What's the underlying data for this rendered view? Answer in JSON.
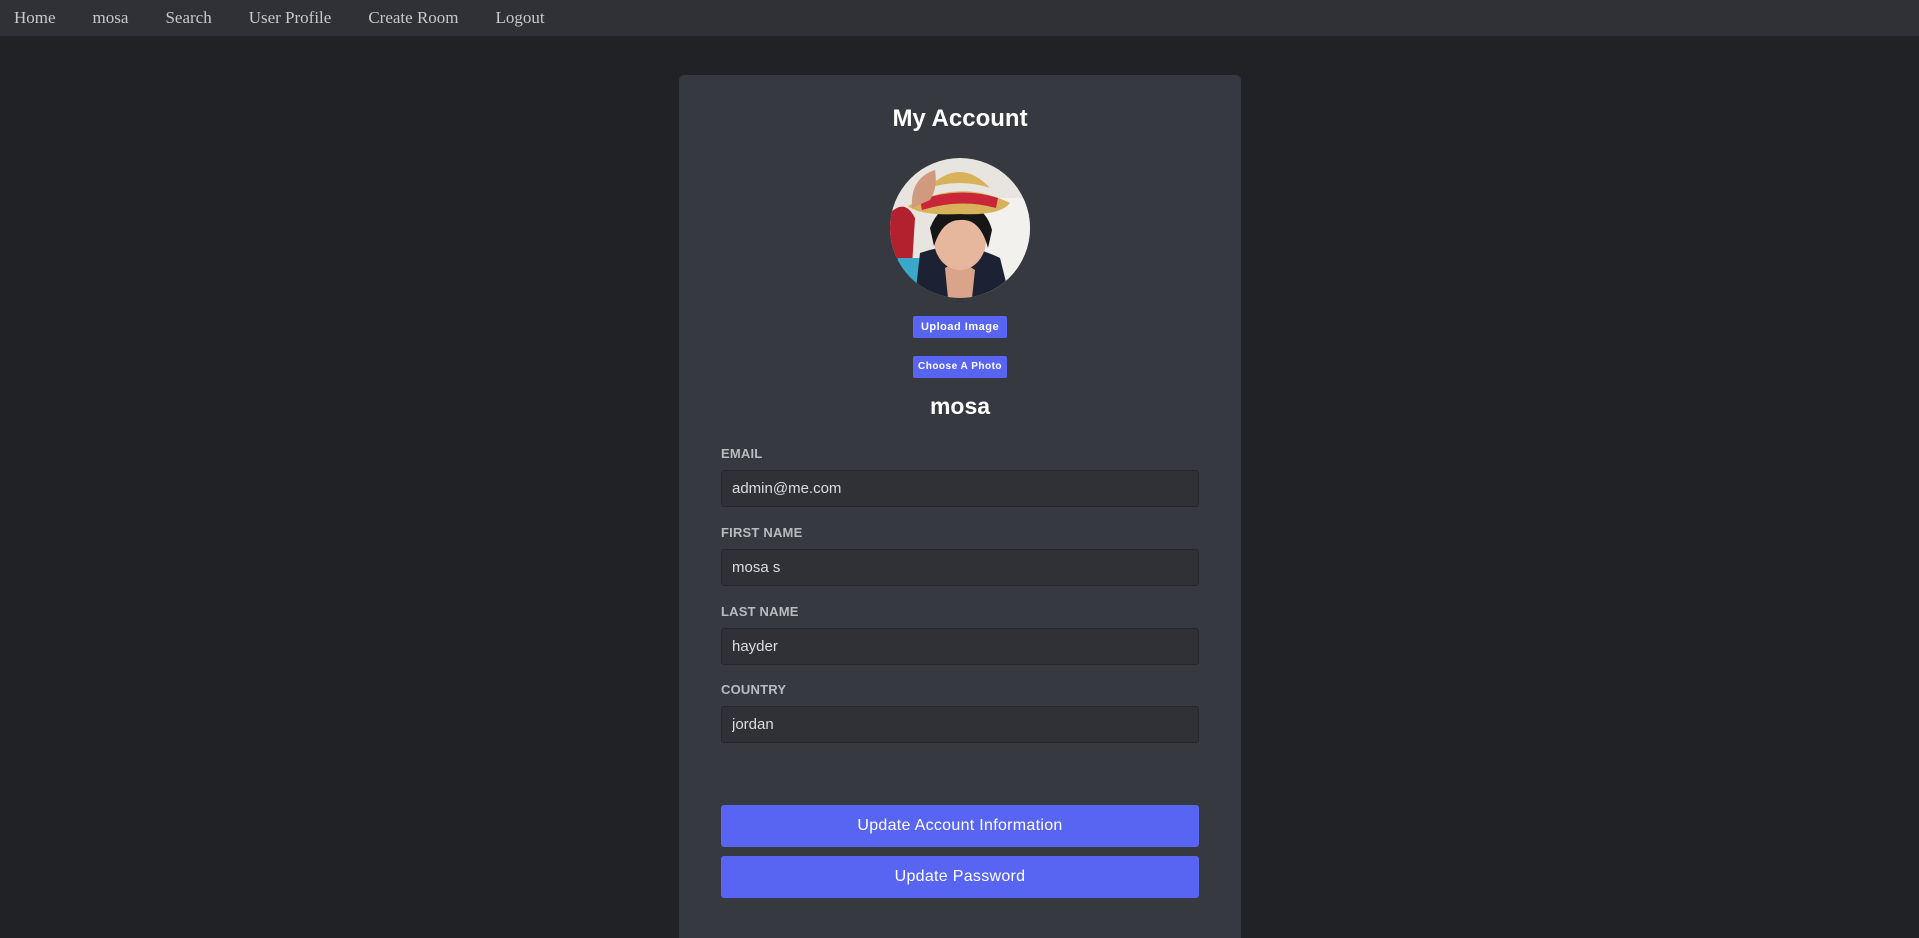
{
  "nav": {
    "items": [
      {
        "label": "Home"
      },
      {
        "label": "mosa"
      },
      {
        "label": "Search"
      },
      {
        "label": "User Profile"
      },
      {
        "label": "Create Room"
      },
      {
        "label": "Logout"
      }
    ]
  },
  "account": {
    "title": "My Account",
    "upload_label": "Upload Image",
    "choose_label": "Choose A Photo",
    "username": "mosa"
  },
  "form": {
    "email": {
      "label": "EMAIL",
      "value": "admin@me.com"
    },
    "first_name": {
      "label": "FIRST NAME",
      "value": "mosa s"
    },
    "last_name": {
      "label": "LAST NAME",
      "value": "hayder"
    },
    "country": {
      "label": "COUNTRY",
      "value": "jordan"
    }
  },
  "actions": {
    "update_info_label": "Update Account Information",
    "update_password_label": "Update Password"
  },
  "colors": {
    "page_bg": "#202225",
    "navbar_bg": "#2f3136",
    "card_bg": "#36393f",
    "accent": "#5865f2"
  }
}
